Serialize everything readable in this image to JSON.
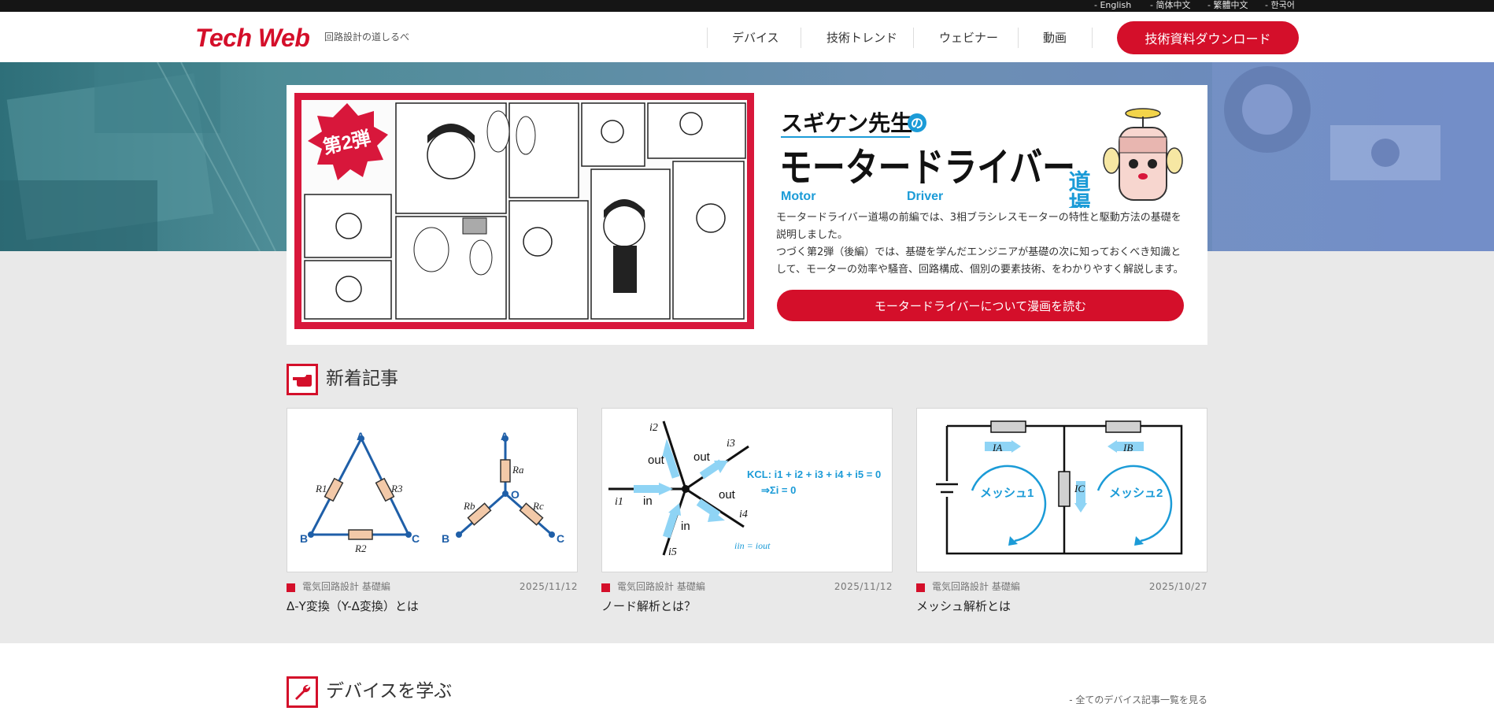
{
  "languages": [
    "- English",
    "- 简体中文",
    "- 繁體中文",
    "- 한국어"
  ],
  "header": {
    "logo": "Tech Web",
    "tagline": "回路設計の道しるべ",
    "nav": [
      "デバイス",
      "技術トレンド",
      "ウェビナー",
      "動画"
    ],
    "download_label": "技術資料ダウンロード"
  },
  "colors": {
    "brand_red": "#d40f2a",
    "frame_red": "#d8173b",
    "accent_blue": "#1b9bd7"
  },
  "hero": {
    "badge": "第2弾",
    "title_top": "スギケン先生",
    "title_no": "の",
    "title_main": "モータードライバー",
    "title_dojo": "道場",
    "title_sub_motor": "Motor",
    "title_sub_driver": "Driver",
    "description_line1": "モータードライバー道場の前編では、3相ブラシレスモーターの特性と駆動方法の基礎を説明しました。",
    "description_line2": "つづく第2弾（後編）では、基礎を学んだエンジニアが基礎の次に知っておくべき知識として、モーターの効率や騒音、回路構成、個別の要素技術、をわかりやすく解説します。",
    "button_label": "モータードライバーについて漫画を読む"
  },
  "new_articles": {
    "title": "新着記事",
    "items": [
      {
        "category": "電気回路設計 基礎編",
        "date": "2025/11/12",
        "title": "Δ-Y変換（Y-Δ変換）とは",
        "labels": [
          "A",
          "B",
          "C",
          "R1",
          "R2",
          "R3",
          "A",
          "B",
          "C",
          "O",
          "Ra",
          "Rb",
          "Rc"
        ]
      },
      {
        "category": "電気回路設計 基礎編",
        "date": "2025/11/12",
        "title": "ノード解析とは？",
        "labels": [
          "i2",
          "i3",
          "i1",
          "i4",
          "i5",
          "out",
          "out",
          "in",
          "out",
          "in"
        ],
        "kcl": "KCL: i1 + i2 + i3 + i4 + i5 = 0",
        "sum": "⇒Σi = 0",
        "in_out": "iin = iout"
      },
      {
        "category": "電気回路設計 基礎編",
        "date": "2025/10/27",
        "title": "メッシュ解析とは",
        "labels": [
          "IA",
          "IB",
          "IC",
          "メッシュ1",
          "メッシュ2"
        ]
      }
    ]
  },
  "devices": {
    "title": "デバイスを学ぶ",
    "more_link": "- 全てのデバイス記事一覧を見る"
  }
}
